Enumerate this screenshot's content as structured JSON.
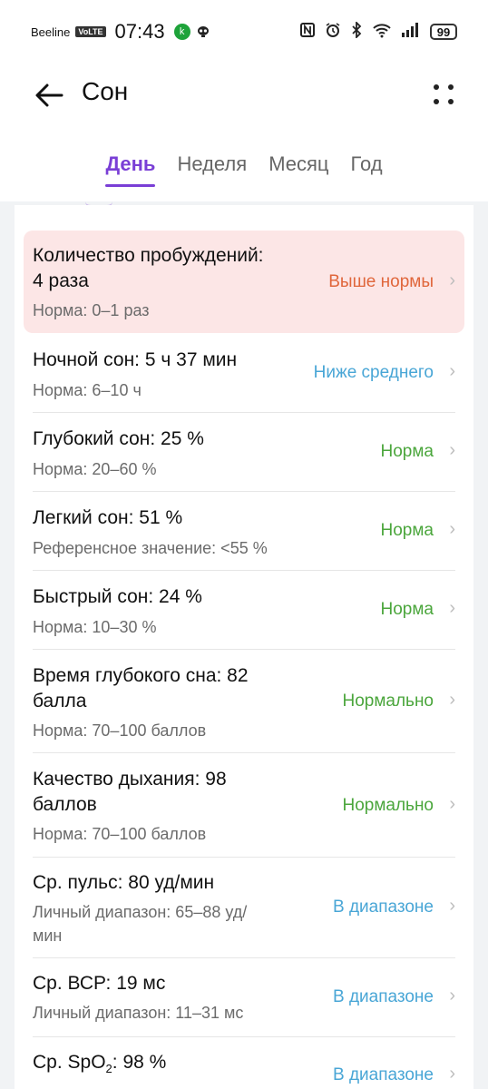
{
  "status_bar": {
    "carrier": "Beeline",
    "volte": "VoLTE",
    "time": "07:43",
    "k_badge": "k",
    "battery": "99"
  },
  "header": {
    "title": "Сон"
  },
  "tabs": [
    {
      "label": "День",
      "active": true
    },
    {
      "label": "Неделя",
      "active": false
    },
    {
      "label": "Месяц",
      "active": false
    },
    {
      "label": "Год",
      "active": false
    }
  ],
  "rows": [
    {
      "title_line1": "Количество пробуждений:",
      "title_line2": "4 раза",
      "sub_line1": "Норма: 0–1 раз",
      "status": "Выше нормы"
    },
    {
      "title_line1": "Ночной сон: 5 ч 37 мин",
      "sub_line1": "Норма: 6–10 ч",
      "status": "Ниже среднего"
    },
    {
      "title_line1": "Глубокий сон: 25 %",
      "sub_line1": "Норма: 20–60 %",
      "status": "Норма"
    },
    {
      "title_line1": "Легкий сон: 51 %",
      "sub_line1": "Референсное значение: <55 %",
      "status": "Норма"
    },
    {
      "title_line1": "Быстрый сон: 24 %",
      "sub_line1": "Норма: 10–30 %",
      "status": "Норма"
    },
    {
      "title_line1": "Время глубокого сна: 82",
      "title_line2": "балла",
      "sub_line1": "Норма: 70–100 баллов",
      "status": "Нормально"
    },
    {
      "title_line1": "Качество дыхания: 98",
      "title_line2": "баллов",
      "sub_line1": "Норма: 70–100 баллов",
      "status": "Нормально"
    },
    {
      "title_line1": "Ср. пульс: 80 уд/мин",
      "sub_line1": "Личный диапазон: 65–88 уд/",
      "sub_line2": "мин",
      "status": "В диапазоне"
    },
    {
      "title_line1": "Ср. ВСР: 19 мс",
      "sub_line1": "Личный диапазон: 11–31 мс",
      "status": "В диапазоне"
    },
    {
      "title_main": "Ср. SpO",
      "title_sub": "2",
      "title_tail": ": 98 %",
      "status": "В диапазоне"
    }
  ],
  "colors": {
    "accent": "#7a3fd6",
    "warn": "#e0663b",
    "info": "#49a6d6",
    "ok": "#4ba63c",
    "highlight_bg": "#fce6e6"
  }
}
